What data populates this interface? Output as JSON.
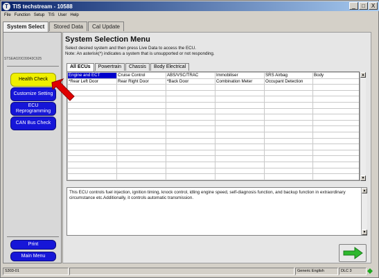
{
  "window": {
    "title": "TIS techstream - 10588",
    "btn_min": "_",
    "btn_max": "□",
    "btn_close": "X"
  },
  "menu": [
    "File",
    "Function",
    "Setup",
    "TIS",
    "User",
    "Help"
  ],
  "top_tabs": [
    "System Select",
    "Stored Data",
    "Cal Update"
  ],
  "sidebar": {
    "serial": "STSEA020C09943C625",
    "buttons": {
      "health_check": "Health Check",
      "customize": "Customize Setting",
      "ecu_reprog": "ECU Reprogramming",
      "can_bus": "CAN Bus Check",
      "print": "Print",
      "main_menu": "Main Menu"
    }
  },
  "main": {
    "title": "System Selection Menu",
    "note1": "Select desired system and then press Live Data to access the ECU.",
    "note2": "Note: An asterisk(*) indicates a system that is unsupported or not responding.",
    "ecu_tabs": [
      "All ECUs",
      "Powertrain",
      "Chassis",
      "Body Electrical"
    ],
    "grid_rows": [
      [
        "Engine and ECT",
        "Cruise Control",
        "ABS/VSC/TRAC",
        "Immobiliser",
        "SRS Airbag",
        "Body"
      ],
      [
        "*Rear Left Door",
        "Rear Right Door",
        "*Back Door",
        "Combination Meter",
        "Occupant Detection",
        ""
      ]
    ],
    "description": "This ECU controls fuel injection, ignition timing, knock control, idling engine speed, self-diagnosis function, and backup function in extraordinary circumstance etc.Additionally, it controls automatic transmission."
  },
  "status": {
    "code": "S303-01",
    "lang": "Generic English",
    "dlc": "DLC 3"
  },
  "colors": {
    "selection": "#0000cc",
    "sidebar_button": "#1616d8",
    "health_check": "#f0f000",
    "arrow": "#e00000",
    "next_arrow": "#2db82d"
  }
}
